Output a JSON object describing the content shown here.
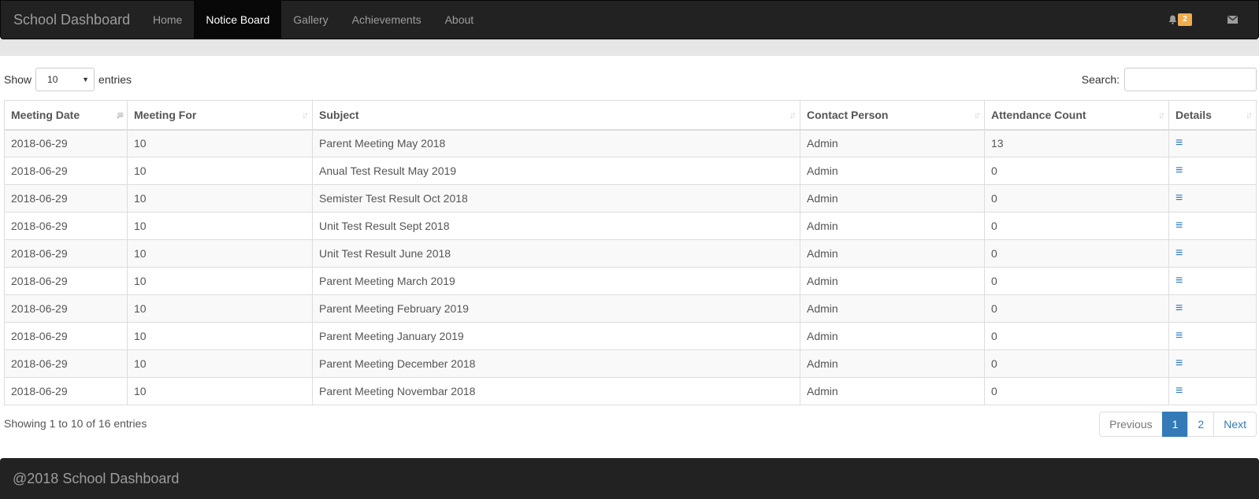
{
  "navbar": {
    "brand": "School Dashboard",
    "items": [
      {
        "label": "Home",
        "active": false
      },
      {
        "label": "Notice Board",
        "active": true
      },
      {
        "label": "Gallery",
        "active": false
      },
      {
        "label": "Achievements",
        "active": false
      },
      {
        "label": "About",
        "active": false
      }
    ],
    "notifications_badge": "2",
    "icons": [
      "bell-icon",
      "envelope-icon"
    ]
  },
  "table_controls": {
    "show_label": "Show",
    "entries_label": "entries",
    "page_size": "10",
    "search_label": "Search:",
    "search_value": ""
  },
  "table": {
    "columns": [
      "Meeting Date",
      "Meeting For",
      "Subject",
      "Contact Person",
      "Attendance Count",
      "Details"
    ],
    "rows": [
      [
        "2018-06-29",
        "10",
        "Parent Meeting May 2018",
        "Admin",
        "13"
      ],
      [
        "2018-06-29",
        "10",
        "Anual Test Result May 2019",
        "Admin",
        "0"
      ],
      [
        "2018-06-29",
        "10",
        "Semister Test Result Oct 2018",
        "Admin",
        "0"
      ],
      [
        "2018-06-29",
        "10",
        "Unit Test Result Sept 2018",
        "Admin",
        "0"
      ],
      [
        "2018-06-29",
        "10",
        "Unit Test Result June 2018",
        "Admin",
        "0"
      ],
      [
        "2018-06-29",
        "10",
        "Parent Meeting March 2019",
        "Admin",
        "0"
      ],
      [
        "2018-06-29",
        "10",
        "Parent Meeting February 2019",
        "Admin",
        "0"
      ],
      [
        "2018-06-29",
        "10",
        "Parent Meeting January 2019",
        "Admin",
        "0"
      ],
      [
        "2018-06-29",
        "10",
        "Parent Meeting December 2018",
        "Admin",
        "0"
      ],
      [
        "2018-06-29",
        "10",
        "Parent Meeting Novembar 2018",
        "Admin",
        "0"
      ]
    ]
  },
  "table_footer": {
    "info": "Showing 1 to 10 of 16 entries",
    "previous": "Previous",
    "pages": [
      "1",
      "2"
    ],
    "current_page": "1",
    "next": "Next"
  },
  "footer": {
    "text": "@2018 School Dashboard"
  },
  "colors": {
    "navbar": "#222222",
    "accent": "#337ab7",
    "badge": "#f0ad4e"
  }
}
